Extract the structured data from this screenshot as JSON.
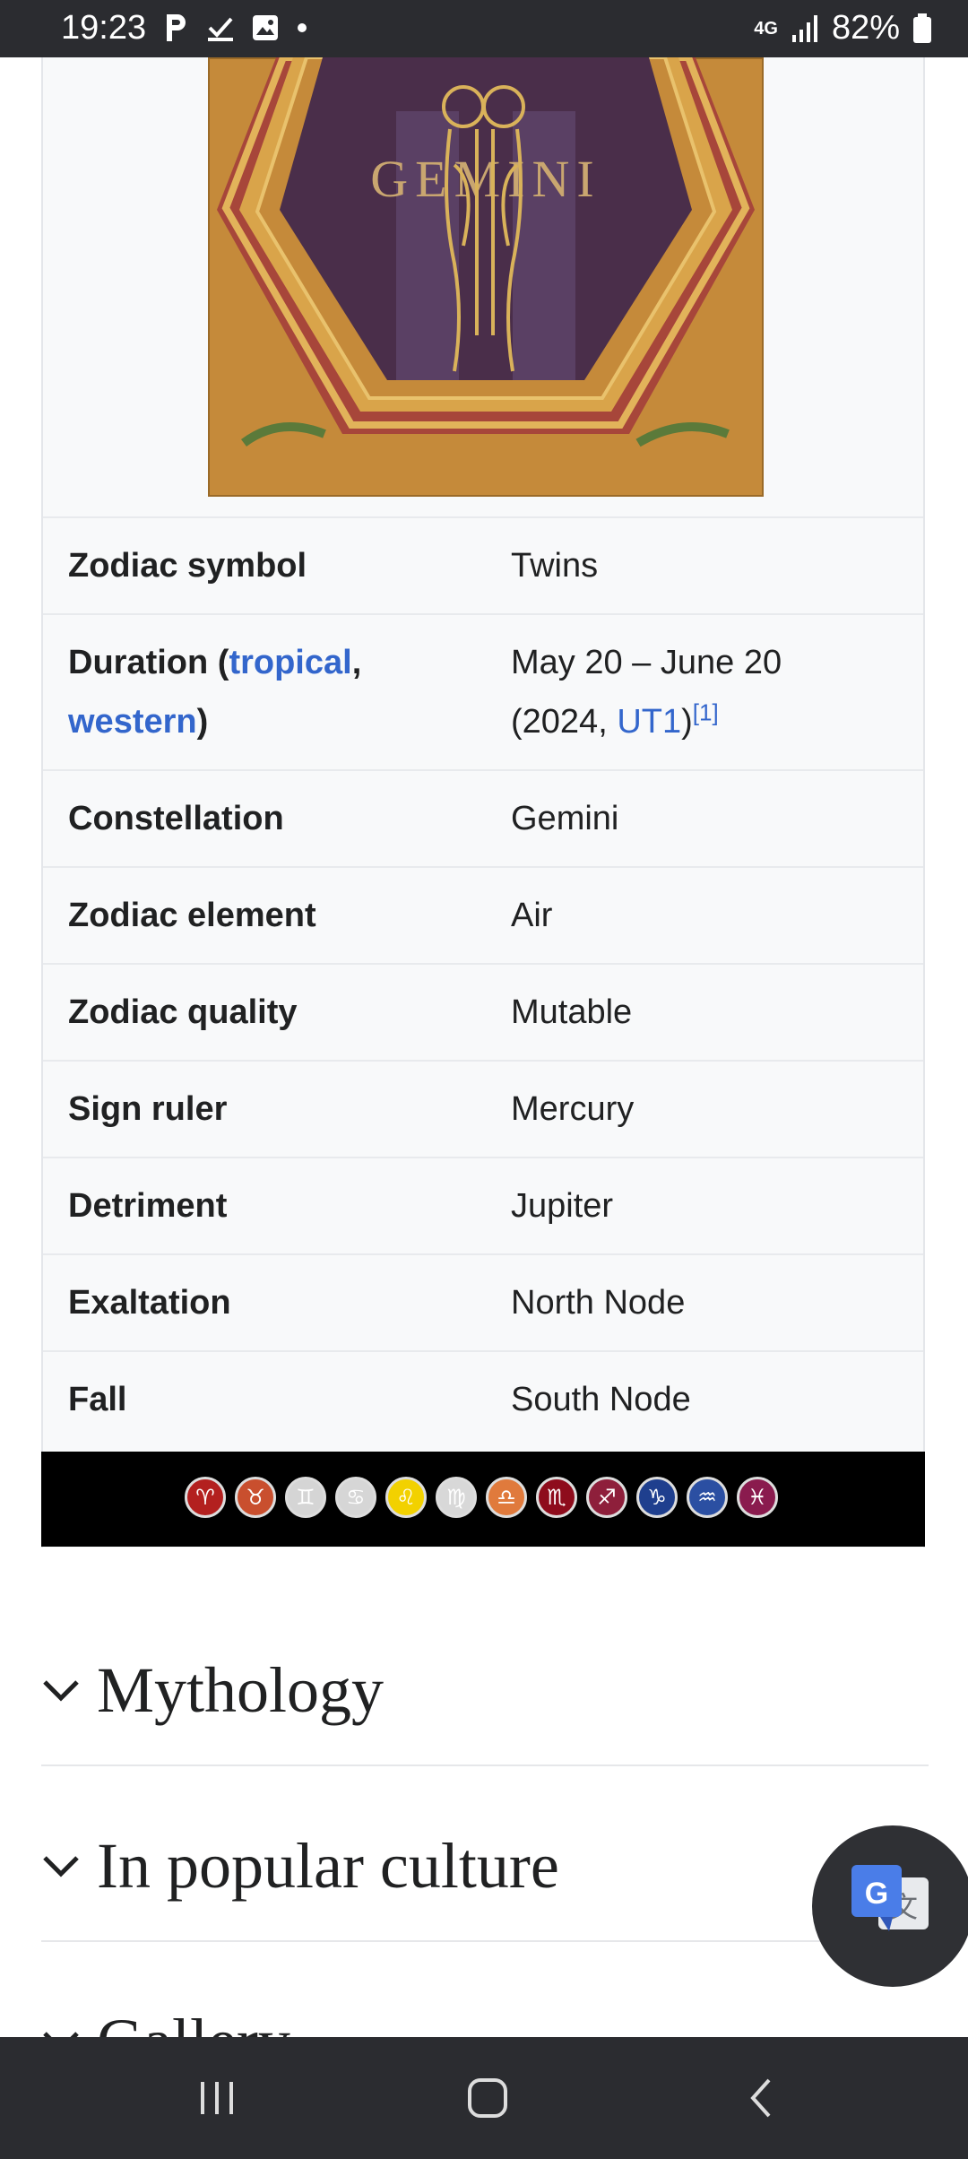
{
  "status_bar": {
    "time": "19:23",
    "network": "4G",
    "battery": "82%"
  },
  "infobox": {
    "image_caption_text": "GEMINI",
    "rows": [
      {
        "label": "Zodiac symbol",
        "label_link": false,
        "value": "Twins"
      },
      {
        "label_parts": [
          "Duration (",
          "tropical",
          ",",
          "western",
          ")"
        ],
        "value_parts": [
          "May 20 – June 20",
          "(2024, ",
          "UT1",
          ")",
          "[1]"
        ]
      },
      {
        "label": "Constellation",
        "value": "Gemini"
      },
      {
        "label": "Zodiac element",
        "value": "Air"
      },
      {
        "label": "Zodiac quality",
        "value": "Mutable"
      },
      {
        "label": "Sign ruler",
        "value": "Mercury"
      },
      {
        "label": "Detriment",
        "value": "Jupiter"
      },
      {
        "label": "Exaltation",
        "value": "North Node"
      },
      {
        "label": "Fall",
        "value": "South Node"
      }
    ],
    "zodiac_symbols": [
      "♈",
      "♉",
      "♊",
      "♋",
      "♌",
      "♍",
      "♎",
      "♏",
      "♐",
      "♑",
      "♒",
      "♓"
    ],
    "zodiac_colors": [
      "#b3201f",
      "#c94f2e",
      "#d5d5d5",
      "#d6d6d6",
      "#f2d100",
      "#d8d8d8",
      "#e07a3c",
      "#8e0c1c",
      "#8e1f3b",
      "#1f3f8e",
      "#2b4fa2",
      "#8a1b4e"
    ]
  },
  "sections": [
    {
      "title": "Mythology"
    },
    {
      "title": "In popular culture"
    },
    {
      "title": "Gallery"
    }
  ],
  "colors": {
    "link": "#3366cc",
    "text": "#202122",
    "bar": "#2b2c30"
  }
}
